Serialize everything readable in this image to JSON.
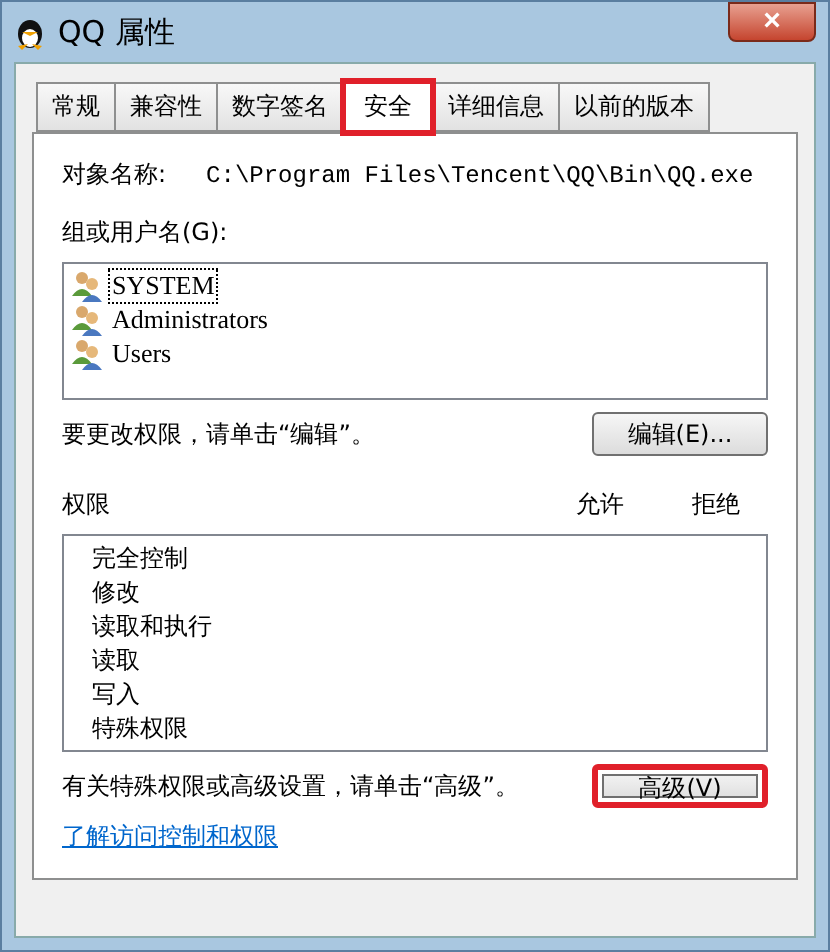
{
  "window": {
    "title": "QQ 属性",
    "close": "×"
  },
  "tabs": [
    {
      "label": "常规",
      "selected": false,
      "highlighted": false
    },
    {
      "label": "兼容性",
      "selected": false,
      "highlighted": false
    },
    {
      "label": "数字签名",
      "selected": false,
      "highlighted": false
    },
    {
      "label": "安全",
      "selected": true,
      "highlighted": true
    },
    {
      "label": "详细信息",
      "selected": false,
      "highlighted": false
    },
    {
      "label": "以前的版本",
      "selected": false,
      "highlighted": false
    }
  ],
  "object_name": {
    "label": "对象名称:",
    "value": "C:\\Program Files\\Tencent\\QQ\\Bin\\QQ.exe"
  },
  "groups": {
    "label": "组或用户名(G):",
    "items": [
      {
        "name": "SYSTEM",
        "selected": true
      },
      {
        "name": "Administrators",
        "selected": false
      },
      {
        "name": "Users",
        "selected": false
      }
    ]
  },
  "edit_hint": "要更改权限，请单击“编辑”。",
  "edit_button": {
    "label": "编辑(E)...",
    "highlighted": false
  },
  "permissions": {
    "label": "权限",
    "columns": [
      "允许",
      "拒绝"
    ],
    "rows": [
      "完全控制",
      "修改",
      "读取和执行",
      "读取",
      "写入",
      "特殊权限"
    ]
  },
  "advanced_hint": "有关特殊权限或高级设置，请单击“高级”。",
  "advanced_button": {
    "label": "高级(V)",
    "highlighted": true
  },
  "link": "了解访问控制和权限"
}
